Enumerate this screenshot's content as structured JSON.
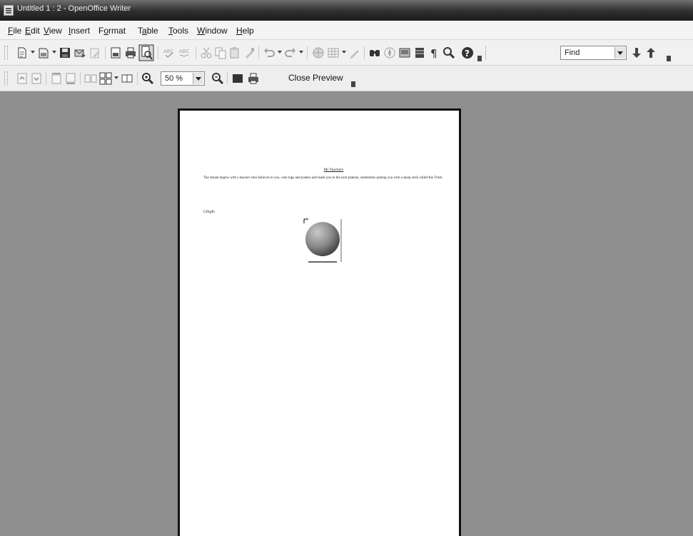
{
  "window": {
    "title": "Untitled 1 : 2 - OpenOffice Writer"
  },
  "menu": {
    "file": [
      "",
      "F",
      "ile"
    ],
    "edit": [
      "",
      "E",
      "dit"
    ],
    "view": [
      "",
      "V",
      "iew"
    ],
    "insert": [
      "",
      "I",
      "nsert"
    ],
    "format": [
      "F",
      "o",
      "rmat"
    ],
    "table": [
      "T",
      "a",
      "ble"
    ],
    "tools": [
      "",
      "T",
      "ools"
    ],
    "window": [
      "",
      "W",
      "indow"
    ],
    "help": [
      "",
      "H",
      "elp"
    ]
  },
  "toolbar": {
    "find_placeholder": "Find"
  },
  "preview_toolbar": {
    "zoom_value": "50 %",
    "close_preview_label": "Close Preview"
  },
  "document": {
    "title": "Mr Teachers",
    "paragraph": "The dream begins with a teacher who believes in you, who tugs and pushes and leads you to the next plateau, sometimes poking you with a sharp stick called the Truth.",
    "line2": "Gfhgfh"
  },
  "icons": {
    "new": "new-document-icon",
    "templates": "templates-icon",
    "save": "save-icon",
    "email": "email-icon",
    "edit_file": "edit-file-icon",
    "export_pdf": "export-pdf-icon",
    "print": "print-icon",
    "page_preview": "page-preview-icon",
    "spellcheck": "spellcheck-icon",
    "autospell": "autospellcheck-icon",
    "cut": "cut-icon",
    "copy": "copy-icon",
    "paste": "paste-icon",
    "clone": "clone-formatting-icon",
    "undo": "undo-icon",
    "redo": "redo-icon",
    "hyperlink": "hyperlink-icon",
    "table": "insert-table-icon",
    "draw": "show-draw-functions-icon",
    "find_replace": "find-replace-icon",
    "navigator": "navigator-icon",
    "gallery": "gallery-icon",
    "data_sources": "data-sources-icon",
    "nonprinting": "nonprinting-characters-icon",
    "zoom": "zoom-icon",
    "help": "help-icon"
  }
}
